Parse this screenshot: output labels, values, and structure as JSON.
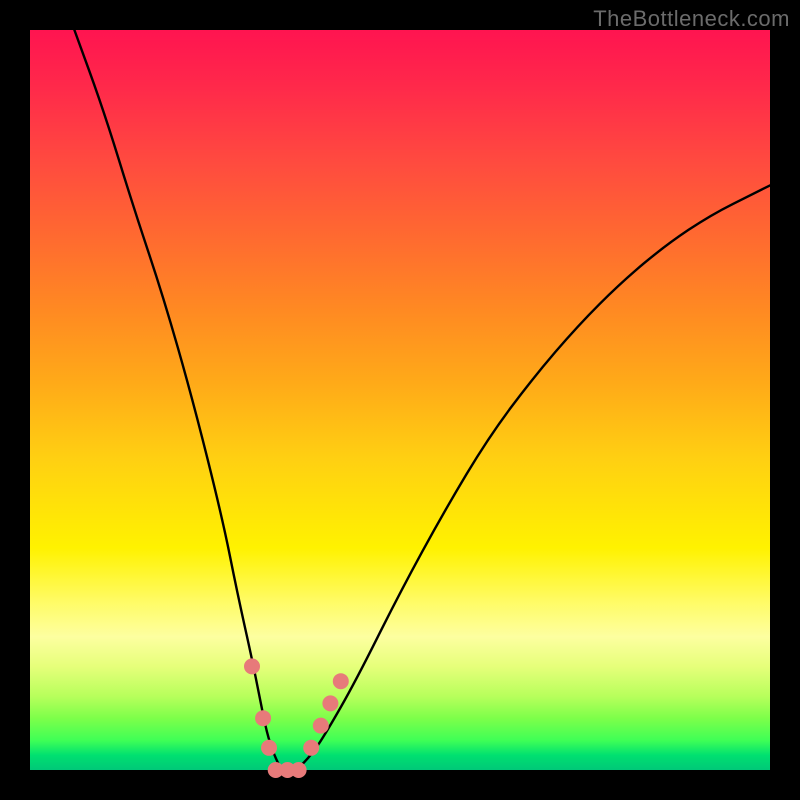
{
  "watermark": "TheBottleneck.com",
  "chart_data": {
    "type": "line",
    "title": "",
    "xlabel": "",
    "ylabel": "",
    "xlim": [
      0,
      100
    ],
    "ylim": [
      0,
      100
    ],
    "grid": false,
    "legend": false,
    "background_gradient": {
      "orientation": "vertical",
      "stops": [
        {
          "pos": 0.0,
          "color": "#ff1450"
        },
        {
          "pos": 0.5,
          "color": "#ffab18"
        },
        {
          "pos": 0.72,
          "color": "#fff200"
        },
        {
          "pos": 0.9,
          "color": "#b8ff5c"
        },
        {
          "pos": 1.0,
          "color": "#00c878"
        }
      ]
    },
    "series": [
      {
        "name": "bottleneck-curve",
        "color": "#000000",
        "x": [
          6,
          10,
          14,
          18,
          22,
          26,
          28,
          30,
          31,
          32,
          33,
          34,
          35,
          36,
          38,
          40,
          44,
          50,
          56,
          62,
          68,
          74,
          80,
          86,
          92,
          98,
          100
        ],
        "y": [
          100,
          89,
          76,
          64,
          50,
          34,
          24,
          15,
          10,
          5,
          2,
          0,
          0,
          0,
          2,
          5,
          12,
          24,
          35,
          45,
          53,
          60,
          66,
          71,
          75,
          78,
          79
        ]
      }
    ],
    "markers": [
      {
        "name": "left-dot-1",
        "x": 30.0,
        "y": 14,
        "color": "#e77a7a"
      },
      {
        "name": "left-dot-2",
        "x": 31.5,
        "y": 7,
        "color": "#e77a7a"
      },
      {
        "name": "left-dot-3",
        "x": 32.3,
        "y": 3,
        "color": "#e77a7a"
      },
      {
        "name": "bottom-dot-1",
        "x": 33.2,
        "y": 0,
        "color": "#e77a7a"
      },
      {
        "name": "bottom-dot-2",
        "x": 34.8,
        "y": 0,
        "color": "#e77a7a"
      },
      {
        "name": "bottom-dot-3",
        "x": 36.3,
        "y": 0,
        "color": "#e77a7a"
      },
      {
        "name": "right-dot-1",
        "x": 38.0,
        "y": 3,
        "color": "#e77a7a"
      },
      {
        "name": "right-dot-2",
        "x": 39.3,
        "y": 6,
        "color": "#e77a7a"
      },
      {
        "name": "right-dot-3",
        "x": 40.6,
        "y": 9,
        "color": "#e77a7a"
      },
      {
        "name": "right-dot-4",
        "x": 42.0,
        "y": 12,
        "color": "#e77a7a"
      }
    ]
  }
}
